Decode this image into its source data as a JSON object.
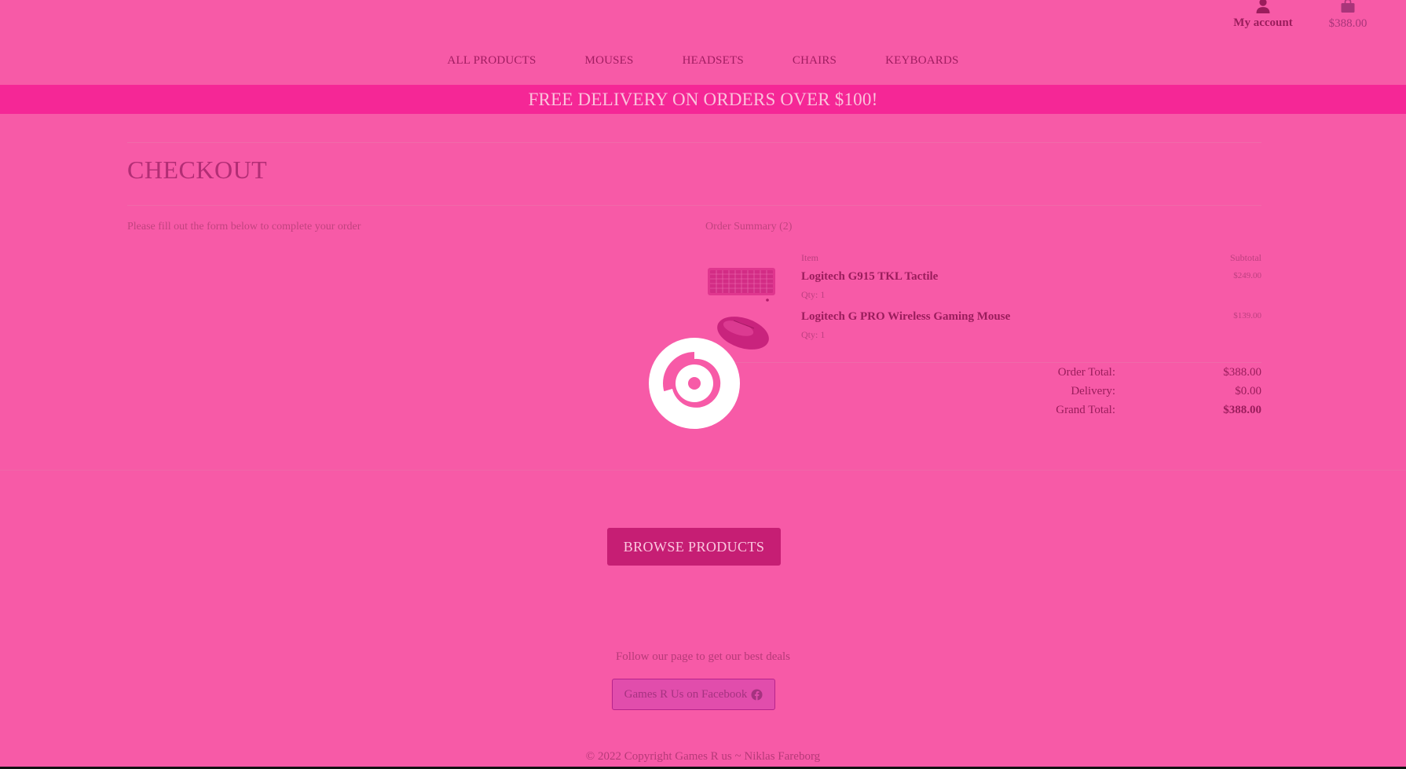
{
  "header": {
    "account_label": "My account",
    "account_icon": "user-icon",
    "cart_total": "$388.00",
    "cart_icon": "shopping-bag-icon"
  },
  "nav": {
    "items": [
      {
        "label": "ALL PRODUCTS"
      },
      {
        "label": "MOUSES"
      },
      {
        "label": "HEADSETS"
      },
      {
        "label": "CHAIRS"
      },
      {
        "label": "KEYBOARDS"
      }
    ]
  },
  "banner": {
    "text": "FREE DELIVERY ON ORDERS OVER $100!"
  },
  "checkout": {
    "title": "CHECKOUT",
    "form_intro": "Please fill out the form below to complete your order",
    "summary_title": "Order Summary (2)",
    "col_item": "Item",
    "col_subtotal": "Subtotal",
    "items": [
      {
        "name": "Logitech G915 TKL Tactile",
        "qty": "Qty: 1",
        "price": "$249.00",
        "icon": "keyboard-thumbnail"
      },
      {
        "name": "Logitech G PRO Wireless Gaming Mouse",
        "qty": "Qty: 1",
        "price": "$139.00",
        "icon": "mouse-thumbnail"
      }
    ],
    "totals": {
      "order_total_label": "Order Total:",
      "order_total": "$388.00",
      "delivery_label": "Delivery:",
      "delivery": "$0.00",
      "grand_total_label": "Grand Total:",
      "grand_total": "$388.00"
    }
  },
  "actions": {
    "browse_label": "BROWSE PRODUCTS"
  },
  "footer": {
    "follow_text": "Follow our page to get our best deals",
    "facebook_label": "Games R Us on Facebook",
    "facebook_icon": "facebook-icon",
    "copyright": "© 2022 Copyright Games R us ~ Niklas Fareborg"
  },
  "overlay": {
    "spinner_icon": "loading-spinner-icon"
  },
  "colors": {
    "background": "#f75aa7",
    "banner": "#f52796",
    "accent": "#c61e74"
  }
}
